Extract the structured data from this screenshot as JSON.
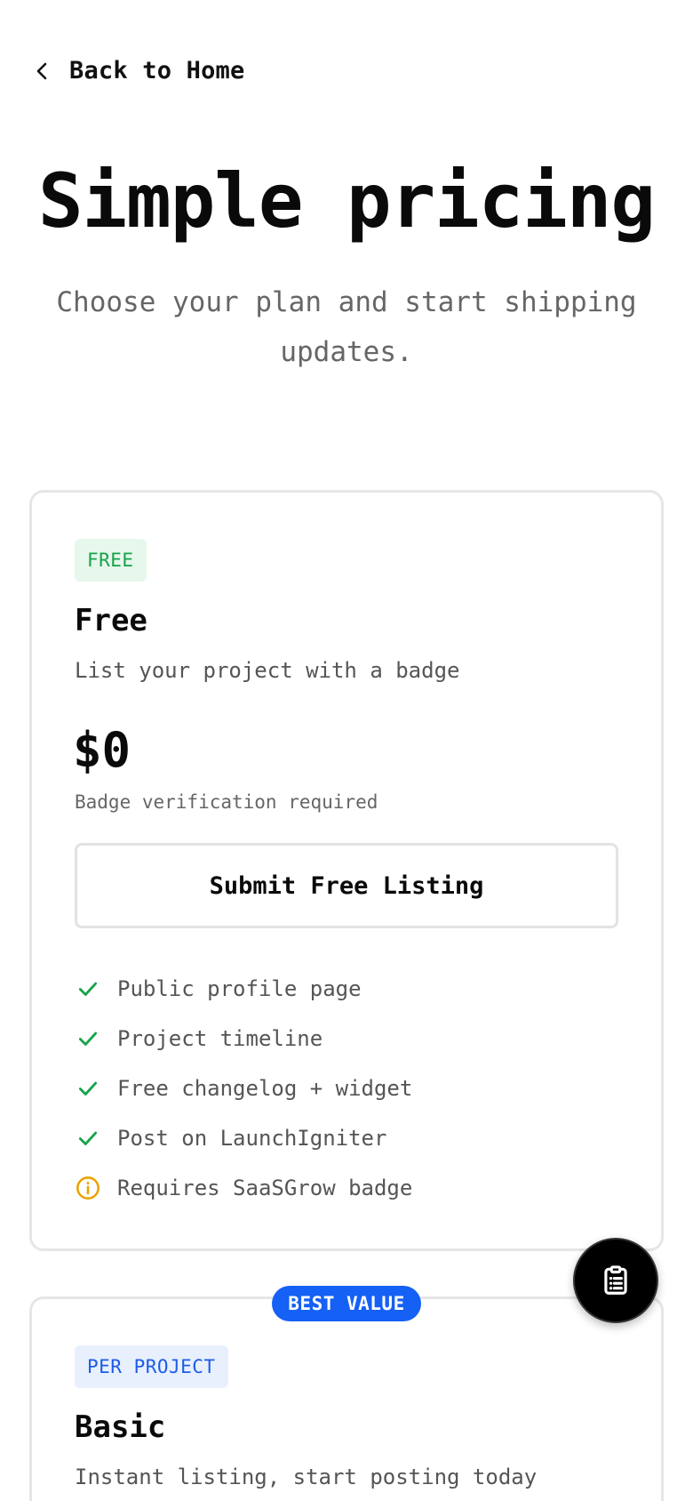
{
  "nav": {
    "back_label": "Back to Home"
  },
  "hero": {
    "title": "Simple pricing",
    "subtitle": "Choose your plan and start shipping updates."
  },
  "plans": [
    {
      "tag": "FREE",
      "name": "Free",
      "description": "List your project with a badge",
      "price": "$0",
      "price_note": "Badge verification required",
      "cta_label": "Submit Free Listing",
      "features": [
        {
          "text": "Public profile page",
          "icon": "check-icon"
        },
        {
          "text": "Project timeline",
          "icon": "check-icon"
        },
        {
          "text": "Free changelog + widget",
          "icon": "check-icon"
        },
        {
          "text": "Post on LaunchIgniter",
          "icon": "check-icon"
        },
        {
          "text": "Requires SaaSGrow badge",
          "icon": "info-icon"
        }
      ]
    },
    {
      "badge": "BEST VALUE",
      "tag": "PER PROJECT",
      "name": "Basic",
      "description": "Instant listing, start posting today"
    }
  ],
  "colors": {
    "accent_blue": "#1560f5",
    "check_green": "#16a34a",
    "info_amber": "#e9a400",
    "tag_green_bg": "#e6f7ec",
    "tag_blue_bg": "#e8f0fe"
  },
  "fab": {
    "icon": "clipboard-icon"
  }
}
